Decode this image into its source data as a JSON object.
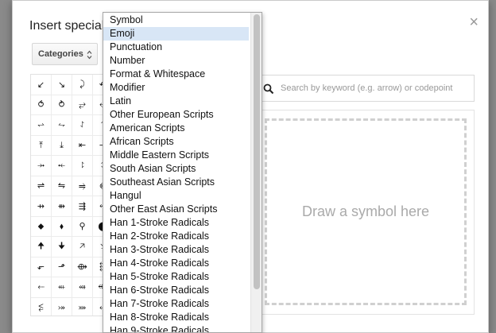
{
  "dialog": {
    "title": "Insert special characters",
    "close_label": "×",
    "category_label": "Categories",
    "search_placeholder": "Search by keyword (e.g. arrow) or codepoint",
    "draw_label": "Draw a symbol here"
  },
  "dropdown": {
    "items": [
      "Symbol",
      "Emoji",
      "Punctuation",
      "Number",
      "Format & Whitespace",
      "Modifier",
      "Latin",
      "Other European Scripts",
      "American Scripts",
      "African Scripts",
      "Middle Eastern Scripts",
      "South Asian Scripts",
      "Southeast Asian Scripts",
      "Hangul",
      "Other East Asian Scripts",
      "Han 1-Stroke Radicals",
      "Han 2-Stroke Radicals",
      "Han 3-Stroke Radicals",
      "Han 4-Stroke Radicals",
      "Han 5-Stroke Radicals",
      "Han 6-Stroke Radicals",
      "Han 7-Stroke Radicals",
      "Han 8-Stroke Radicals",
      "Han 9-Stroke Radicals"
    ],
    "selected_index": 1
  },
  "symbol_grid": [
    [
      "↙",
      "↘",
      "⤸",
      "↶",
      ""
    ],
    [
      "⥀",
      "⥁",
      "⥂",
      "⥃",
      ""
    ],
    [
      "⥋",
      "⥊",
      "⥌",
      "⥍",
      ""
    ],
    [
      "⤒",
      "⤓",
      "⇤",
      "⇥",
      ""
    ],
    [
      "⤞",
      "⤝",
      "⥏",
      "⥑",
      ""
    ],
    [
      "⇌",
      "⇋",
      "⥤",
      "⥢",
      ""
    ],
    [
      "⇸",
      "⇻",
      "⇶",
      "⥷",
      ""
    ],
    [
      "⬥",
      "⬧",
      "⚲",
      "⬤",
      ""
    ],
    [
      "🠉",
      "🠋",
      "🡥",
      "🡦",
      ""
    ],
    [
      "⬐",
      "⬏",
      "⟴",
      "⬱",
      ""
    ],
    [
      "⬸",
      "⬴",
      "⬵",
      "⬲",
      ""
    ],
    [
      "⥶",
      "⤖",
      "⤗",
      "⬹",
      ""
    ]
  ]
}
